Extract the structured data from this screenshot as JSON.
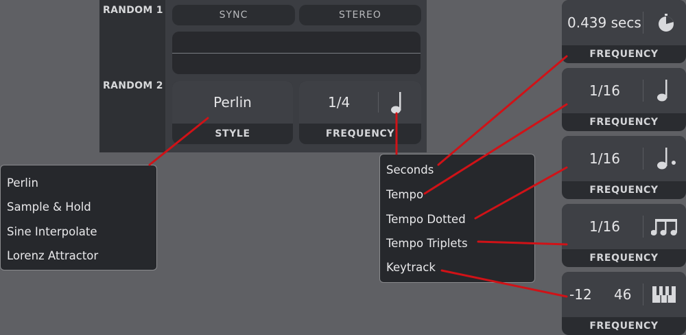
{
  "panel": {
    "random1_label": "RANDOM 1",
    "random2_label": "RANDOM 2",
    "sync_label": "SYNC",
    "stereo_label": "STEREO",
    "style_value": "Perlin",
    "style_label": "STYLE",
    "frequency_value": "1/4",
    "frequency_label": "FREQUENCY"
  },
  "style_menu": {
    "items": [
      "Perlin",
      "Sample & Hold",
      "Sine Interpolate",
      "Lorenz Attractor"
    ]
  },
  "frequency_menu": {
    "items": [
      "Seconds",
      "Tempo",
      "Tempo Dotted",
      "Tempo Triplets",
      "Keytrack"
    ]
  },
  "frequency_cards": [
    {
      "value": "0.439 secs",
      "label": "FREQUENCY",
      "icon": "stopwatch-icon"
    },
    {
      "value": "1/16",
      "label": "FREQUENCY",
      "icon": "quarter-note-icon"
    },
    {
      "value": "1/16",
      "label": "FREQUENCY",
      "icon": "dotted-note-icon"
    },
    {
      "value": "1/16",
      "label": "FREQUENCY",
      "icon": "triplet-notes-icon"
    },
    {
      "value_left": "-12",
      "value_right": "46",
      "label": "FREQUENCY",
      "icon": "keyboard-icon"
    }
  ],
  "colors": {
    "background": "#5f6064",
    "panel": "#3b3d42",
    "callout_line": "#d01217",
    "menu_border": "#8a8b8e"
  }
}
